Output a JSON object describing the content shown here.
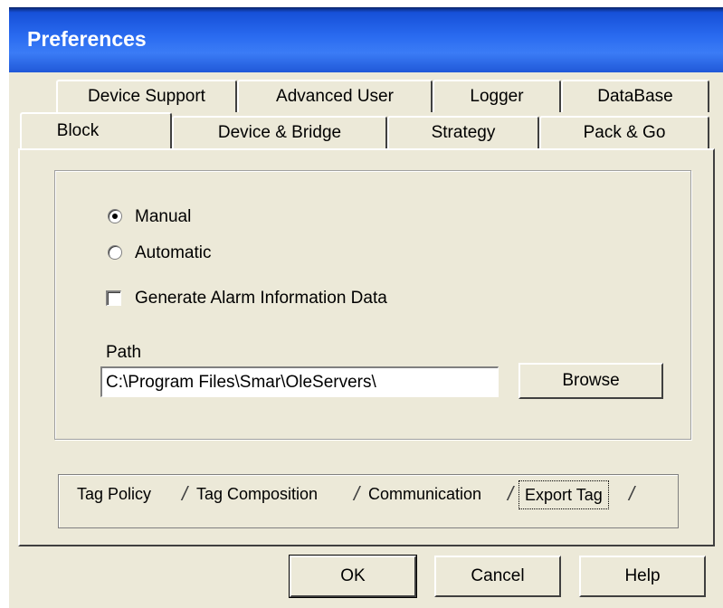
{
  "window": {
    "title": "Preferences"
  },
  "tabs_row1": [
    "Device Support",
    "Advanced User",
    "Logger",
    "DataBase"
  ],
  "tabs_row2": [
    "Block",
    "Device & Bridge",
    "Strategy",
    "Pack & Go"
  ],
  "selected_tab": "Block",
  "options": {
    "manual_label": "Manual",
    "automatic_label": "Automatic",
    "selected": "Manual",
    "generate_alarm_label": "Generate Alarm Information Data",
    "generate_alarm_checked": false
  },
  "path": {
    "label": "Path",
    "value": "C:\\Program Files\\Smar\\OleServers\\",
    "browse_label": "Browse"
  },
  "subtabs": [
    "Tag Policy",
    "Tag Composition",
    "Communication",
    "Export Tag"
  ],
  "selected_subtab": "Export Tag",
  "buttons": {
    "ok": "OK",
    "cancel": "Cancel",
    "help": "Help"
  }
}
